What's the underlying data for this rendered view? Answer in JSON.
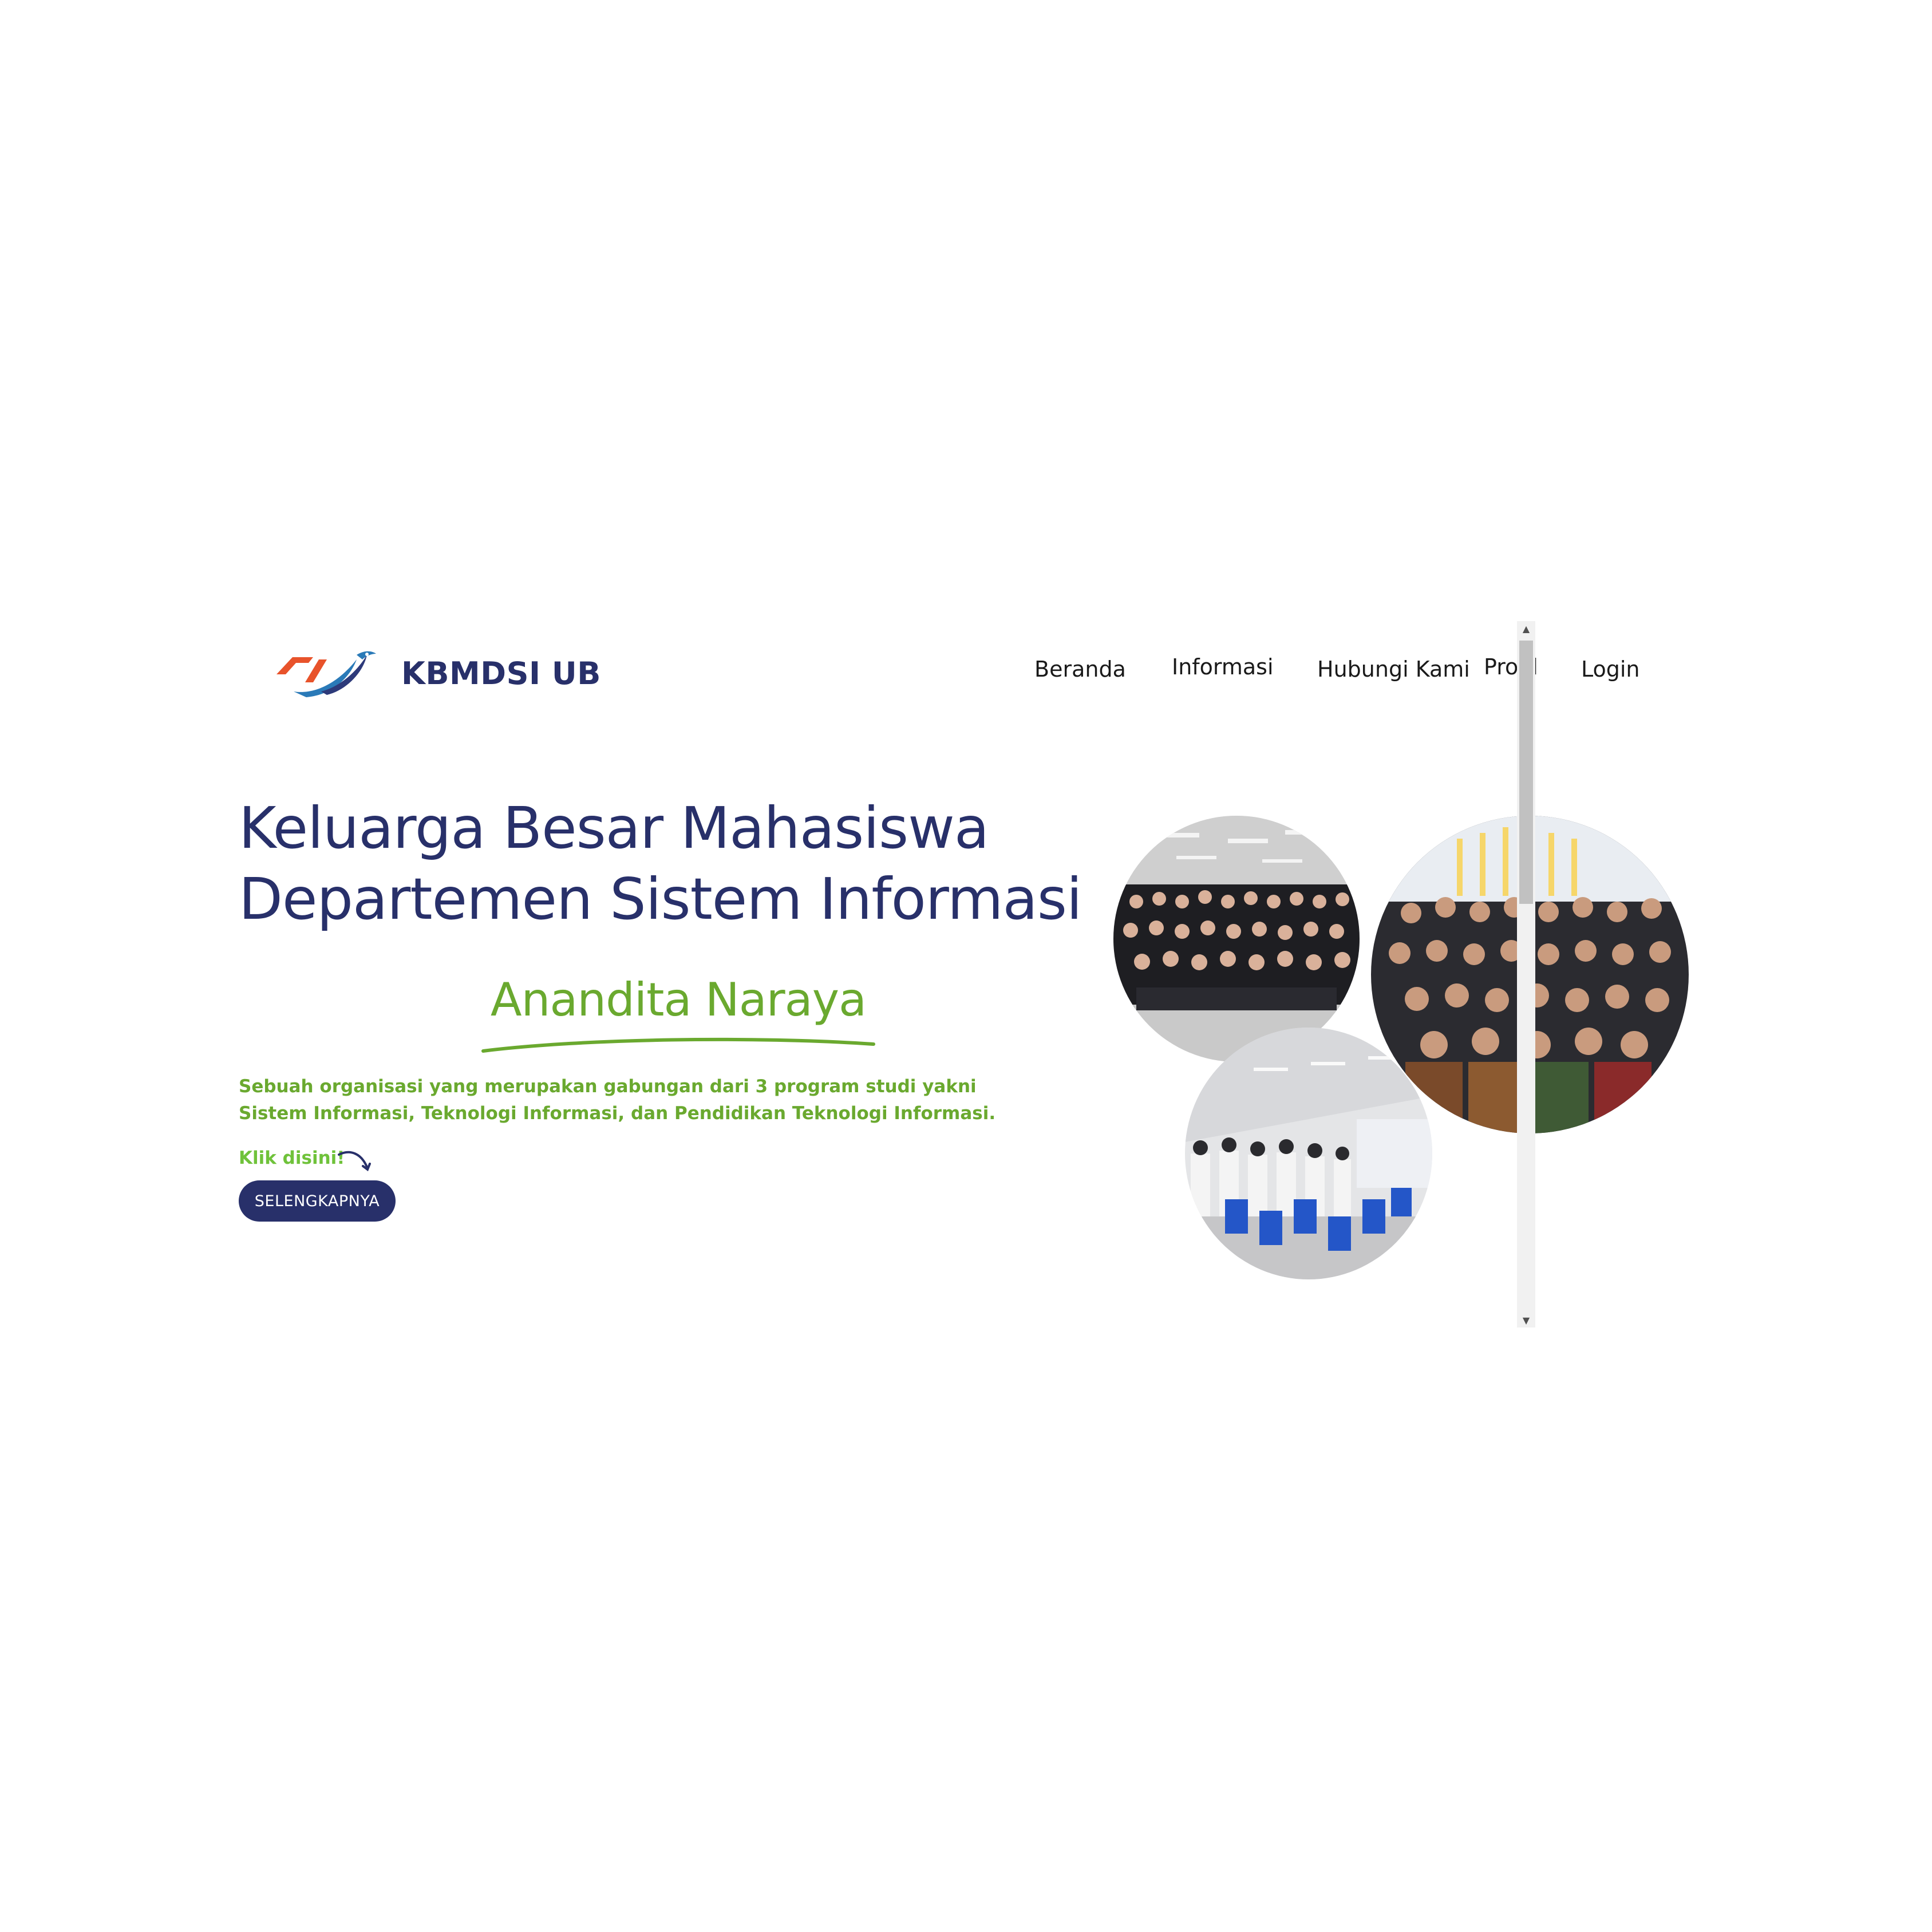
{
  "brand": {
    "name": "KBMDSI UB",
    "logo_icon": "kbmdsi-bird-logo"
  },
  "nav": {
    "items": [
      {
        "label": "Beranda"
      },
      {
        "label": "Informasi"
      },
      {
        "label": "Hubungi Kami"
      },
      {
        "label": "Profil"
      },
      {
        "label": "Login"
      }
    ]
  },
  "hero": {
    "title_line1": "Keluarga Besar Mahasiswa",
    "title_line2": "Departemen Sistem Informasi",
    "name": "Anandita Naraya",
    "desc_line1": "Sebuah organisasi yang merupakan gabungan dari 3 program studi yakni",
    "desc_line2": "Sistem Informasi, Teknologi Informasi, dan Pendidikan Teknologi Informasi.",
    "klik": "Klik disini!",
    "cta": "SELENGKAPNYA"
  },
  "photos": [
    {
      "name": "group-photo-hall"
    },
    {
      "name": "group-photo-event"
    },
    {
      "name": "group-photo-auditorium"
    }
  ],
  "colors": {
    "navy": "#28306a",
    "green": "#6aa92f",
    "logo_orange": "#e8532b",
    "logo_blue": "#2a7ab8"
  }
}
